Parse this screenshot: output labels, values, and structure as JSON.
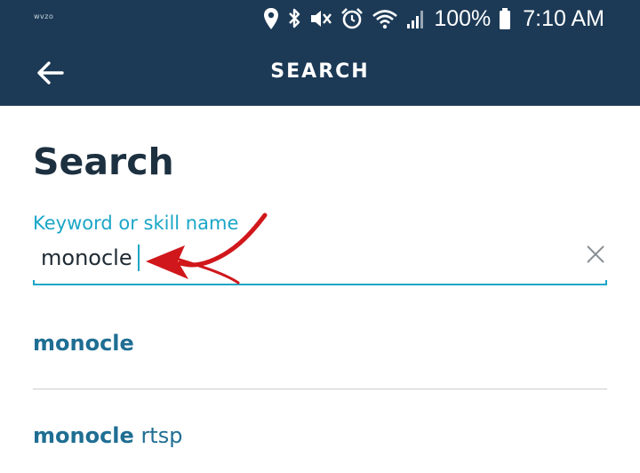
{
  "status_bar": {
    "carrier": "wvzo",
    "battery_percent": "100%",
    "time": "7:10 AM",
    "icons": [
      "location-icon",
      "bluetooth-icon",
      "mute-icon",
      "alarm-icon",
      "wifi-icon",
      "signal-icon",
      "battery-icon"
    ]
  },
  "toolbar": {
    "title": "SEARCH",
    "back_icon": "arrow-left-icon"
  },
  "page": {
    "title": "Search"
  },
  "search": {
    "label": "Keyword or skill name",
    "value": "monocle",
    "clear_icon": "close-icon"
  },
  "suggestions": [
    {
      "match": "monocle",
      "rest": ""
    },
    {
      "match": "monocle",
      "rest": " rtsp"
    }
  ],
  "annotation": {
    "icon": "red-arrow-icon"
  },
  "colors": {
    "appbar": "#1c3a56",
    "accent": "#1ba6c7",
    "title_text": "#1c3040",
    "suggestion_text": "#1f6e93",
    "annotation": "#d0171b"
  }
}
